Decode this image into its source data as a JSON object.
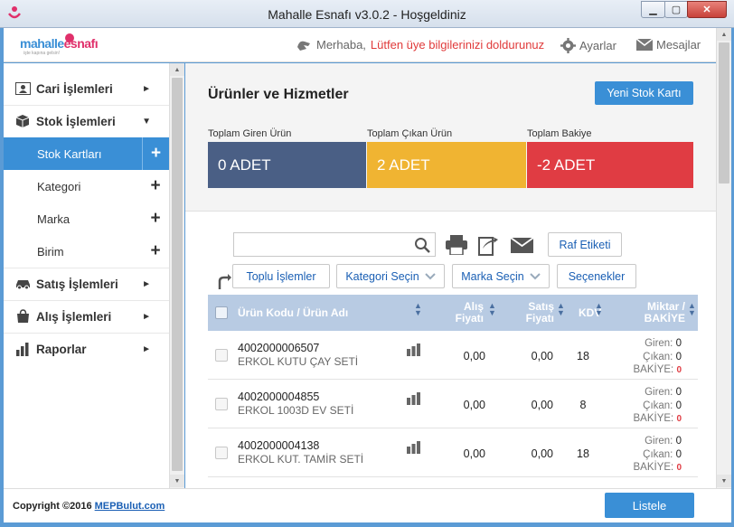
{
  "window": {
    "title": "Mahalle Esnafı v3.0.2 - Hoşgeldiniz",
    "min": "▁",
    "max": "▢",
    "close": "✕"
  },
  "header": {
    "logo_a": "mahalle",
    "logo_b": "esnafı",
    "logo_sub": "işte kapına gelsin!",
    "greeting": "Merhaba,",
    "greeting_warn": "Lütfen üye bilgilerinizi doldurunuz",
    "settings": "Ayarlar",
    "messages": "Mesajlar"
  },
  "sidebar": {
    "items": [
      {
        "label": "Cari İşlemleri",
        "icon": "contact-card-icon",
        "arrow": "►"
      },
      {
        "label": "Stok İşlemleri",
        "icon": "box-icon",
        "arrow": "▼"
      },
      {
        "label": "Satış İşlemleri",
        "icon": "car-icon",
        "arrow": "►"
      },
      {
        "label": "Alış İşlemleri",
        "icon": "bag-icon",
        "arrow": "►"
      },
      {
        "label": "Raporlar",
        "icon": "chart-icon",
        "arrow": "►"
      }
    ],
    "sub_items": [
      {
        "label": "Stok Kartları",
        "plus": "+"
      },
      {
        "label": "Kategori",
        "plus": "+"
      },
      {
        "label": "Marka",
        "plus": "+"
      },
      {
        "label": "Birim",
        "plus": "+"
      }
    ]
  },
  "main": {
    "title": "Ürünler ve Hizmetler",
    "new_button": "Yeni Stok Kartı",
    "stats": [
      {
        "label": "Toplam Giren Ürün",
        "value": "0 ADET",
        "color": "#4a5f85"
      },
      {
        "label": "Toplam Çıkan Ürün",
        "value": "2 ADET",
        "color": "#f0b432"
      },
      {
        "label": "Toplam Bakiye",
        "value": "-2 ADET",
        "color": "#e03c43"
      }
    ],
    "search": {
      "value": "",
      "placeholder": ""
    },
    "raf_button": "Raf Etiketi",
    "bulk_button": "Toplu İşlemler",
    "category_button": "Kategori Seçin",
    "brand_button": "Marka Seçin",
    "options_button": "Seçenekler",
    "columns": {
      "code_name": "Ürün Kodu / Ürün Adı",
      "buy_1": "Alış",
      "buy_2": "Fiyatı",
      "sell_1": "Satış",
      "sell_2": "Fiyatı",
      "kdv": "KDV",
      "qty_1": "Miktar /",
      "qty_2": "BAKİYE"
    },
    "qty_labels": {
      "in": "Giren:",
      "out": "Çıkan:",
      "balance": "BAKİYE:"
    },
    "rows": [
      {
        "code": "4002000006507",
        "name": "ERKOL KUTU ÇAY SETİ",
        "buy": "0,00",
        "sell": "0,00",
        "kdv": "18",
        "in": "0",
        "out": "0",
        "balance": "0"
      },
      {
        "code": "4002000004855",
        "name": "ERKOL 1003D EV SETİ",
        "buy": "0,00",
        "sell": "0,00",
        "kdv": "8",
        "in": "0",
        "out": "0",
        "balance": "0"
      },
      {
        "code": "4002000004138",
        "name": "ERKOL KUT. TAMİR SETİ",
        "buy": "0,00",
        "sell": "0,00",
        "kdv": "18",
        "in": "0",
        "out": "0",
        "balance": "0"
      }
    ]
  },
  "footer": {
    "copyright": "Copyright ©2016",
    "company": "MEPBulut.com",
    "list_button": "Listele"
  }
}
